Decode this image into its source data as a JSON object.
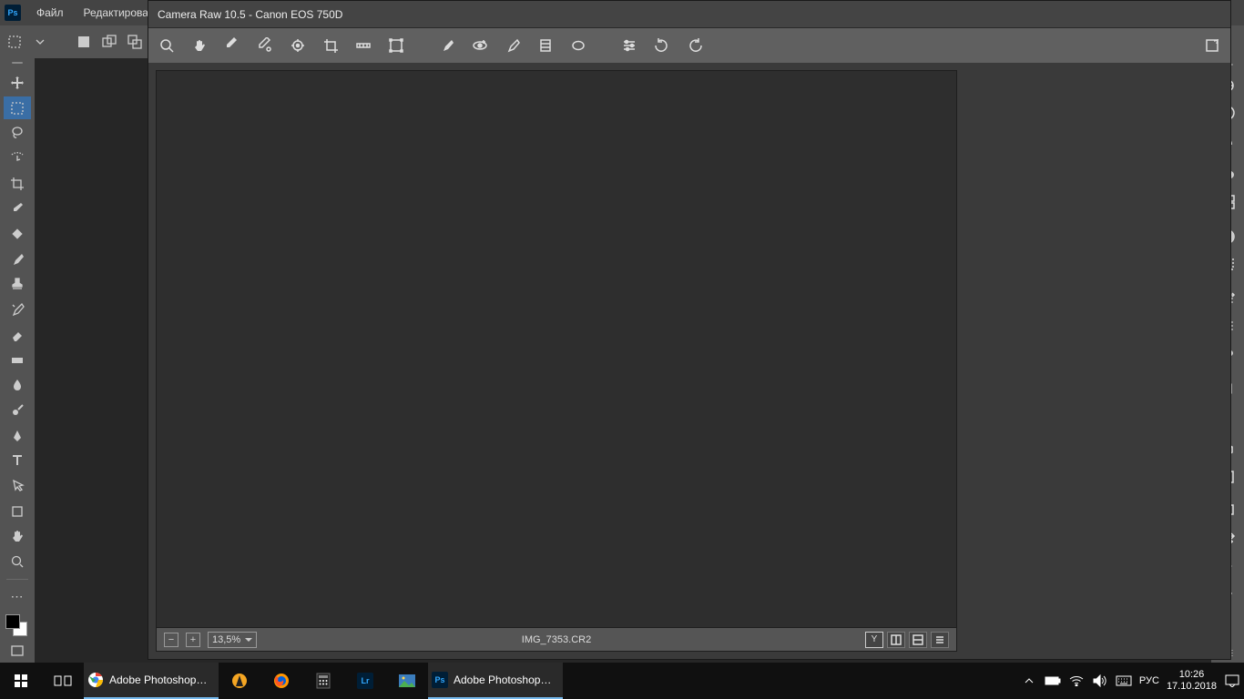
{
  "ps": {
    "logo": "Ps",
    "menu": [
      "Файл",
      "Редактирован"
    ]
  },
  "cameraRaw": {
    "title": "Camera Raw 10.5  -  Canon EOS 750D",
    "zoomMinus": "−",
    "zoomPlus": "+",
    "zoom": "13,5%",
    "filename": "IMG_7353.CR2",
    "yMark": "Y"
  },
  "taskbar": {
    "chromeLabel": "Adobe Photoshop ...",
    "psLabel": "Adobe Photoshop ...",
    "lang": "РУС",
    "time": "10:26",
    "date": "17.10.2018",
    "lr": "Lr",
    "ps": "Ps"
  }
}
